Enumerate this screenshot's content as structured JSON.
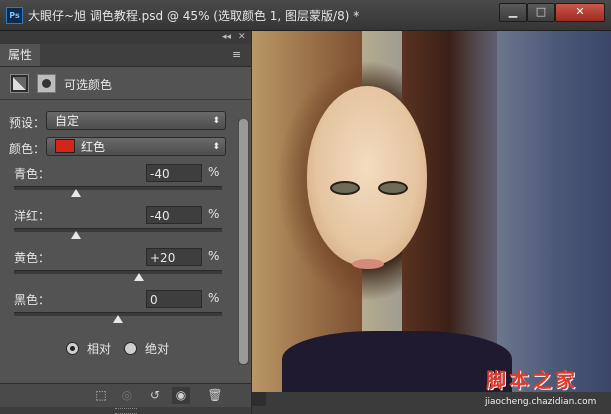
{
  "window": {
    "app_icon": "Ps",
    "title": "大眼仔~旭 调色教程.psd @ 45% (选取颜色 1, 图层蒙版/8) *",
    "controls": {
      "minimize": "▁",
      "maximize": "□",
      "close": "✕"
    }
  },
  "panel": {
    "tab": "属性",
    "collapse": "◂◂",
    "close": "✕",
    "menu": "≡",
    "adjustment_name": "可选颜色",
    "preset_label": "预设：",
    "preset_value": "自定",
    "colors_label": "颜色：",
    "colors_value": "红色",
    "sliders": [
      {
        "label": "青色：",
        "value": "-40",
        "unit": "%",
        "percent": -40
      },
      {
        "label": "洋红：",
        "value": "-40",
        "unit": "%",
        "percent": -40
      },
      {
        "label": "黄色：",
        "value": "+20",
        "unit": "%",
        "percent": 20
      },
      {
        "label": "黑色：",
        "value": "0",
        "unit": "%",
        "percent": 0
      }
    ],
    "method": {
      "relative": "相对",
      "absolute": "绝对",
      "selected": "relative"
    }
  },
  "watermark": {
    "text": "脚本之家",
    "url": "jiaocheng.chazidian.com"
  },
  "colors": {
    "accent_red": "#d3251a",
    "panel_bg": "#535353",
    "close_btn": "#c0392b"
  }
}
